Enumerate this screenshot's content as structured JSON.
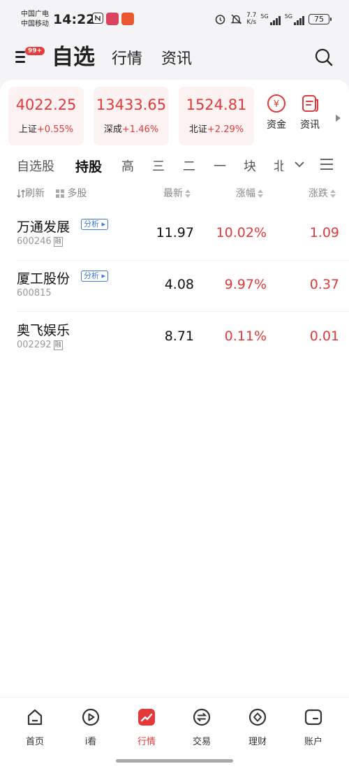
{
  "status_bar": {
    "carrier_1": "中国广电",
    "carrier_2": "中国移动",
    "time": "14:22",
    "speed_top": "7.7",
    "speed_unit": "K/s",
    "net_1": "5G",
    "net_2": "5G",
    "battery": "75"
  },
  "header": {
    "menu_badge": "99+",
    "tabs": [
      "自选",
      "行情",
      "资讯"
    ],
    "active_tab": "自选"
  },
  "indices": [
    {
      "value": "4022.25",
      "name": "上证",
      "change": "+0.55%"
    },
    {
      "value": "13433.65",
      "name": "深成",
      "change": "+1.46%"
    },
    {
      "value": "1524.81",
      "name": "北证",
      "change": "+2.29%"
    }
  ],
  "quick_links": [
    {
      "label": "资金",
      "icon": "yuan-circle-icon"
    },
    {
      "label": "资讯",
      "icon": "news-doc-icon"
    }
  ],
  "filter_tabs": [
    "自选股",
    "持股",
    "高",
    "三",
    "二",
    "一",
    "块",
    "北"
  ],
  "active_filter": "持股",
  "columns": {
    "refresh": "刷新",
    "multi": "多股",
    "latest": "最新",
    "pct_change": "涨幅",
    "change": "涨跌"
  },
  "stocks": [
    {
      "name": "万通发展",
      "code": "600246",
      "tag": "分析",
      "margin": "融",
      "price": "11.97",
      "pct": "10.02%",
      "chg": "1.09"
    },
    {
      "name": "厦工股份",
      "code": "600815",
      "tag": "分析",
      "margin": "",
      "price": "4.08",
      "pct": "9.97%",
      "chg": "0.37"
    },
    {
      "name": "奥飞娱乐",
      "code": "002292",
      "tag": "",
      "margin": "融",
      "price": "8.71",
      "pct": "0.11%",
      "chg": "0.01"
    }
  ],
  "bottom_nav": [
    {
      "label": "首页",
      "icon": "home-icon"
    },
    {
      "label": "i看",
      "icon": "play-icon"
    },
    {
      "label": "行情",
      "icon": "market-chart-icon"
    },
    {
      "label": "交易",
      "icon": "trade-icon"
    },
    {
      "label": "理财",
      "icon": "wealth-icon"
    },
    {
      "label": "账户",
      "icon": "account-icon"
    }
  ],
  "active_nav": "行情",
  "colors": {
    "up_red": "#e23a3a",
    "accent_blue": "#3b7be0"
  }
}
